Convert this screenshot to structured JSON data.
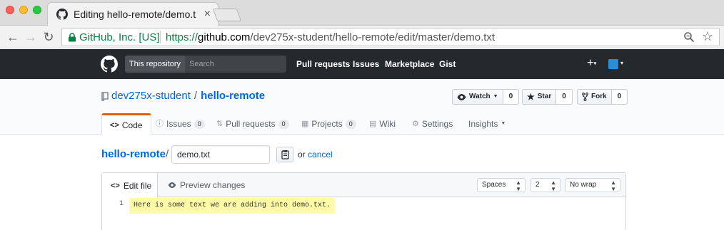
{
  "browser": {
    "tab_title": "Editing hello-remote/demo.txt",
    "tab_close": "×",
    "secure_label": "GitHub, Inc. [US]",
    "url_scheme": "https://",
    "url_host": "github.com",
    "url_path": "/dev275x-student/hello-remote/edit/master/demo.txt"
  },
  "github": {
    "scope_label": "This repository",
    "search_placeholder": "Search",
    "nav": [
      "Pull requests",
      "Issues",
      "Marketplace",
      "Gist"
    ],
    "plus": "+",
    "caret": "▾"
  },
  "repo": {
    "owner": "dev275x-student",
    "slash": "/",
    "name": "hello-remote",
    "watch_label": "Watch",
    "watch_count": "0",
    "star_label": "Star",
    "star_count": "0",
    "fork_label": "Fork",
    "fork_count": "0",
    "tabs": {
      "code": "Code",
      "issues": "Issues",
      "issues_count": "0",
      "pulls": "Pull requests",
      "pulls_count": "0",
      "projects": "Projects",
      "projects_count": "0",
      "wiki": "Wiki",
      "settings": "Settings",
      "insights": "Insights"
    }
  },
  "editor": {
    "path_repo": "hello-remote",
    "path_slash": "/",
    "filename": "demo.txt",
    "or_text": "or",
    "cancel": "cancel",
    "tab_edit": "Edit file",
    "tab_preview": "Preview changes",
    "indent_mode": "Spaces",
    "indent_size": "2",
    "wrap_mode": "No wrap",
    "lines": [
      {
        "num": "1",
        "text": "Here is some text we are adding into demo.txt."
      }
    ]
  }
}
